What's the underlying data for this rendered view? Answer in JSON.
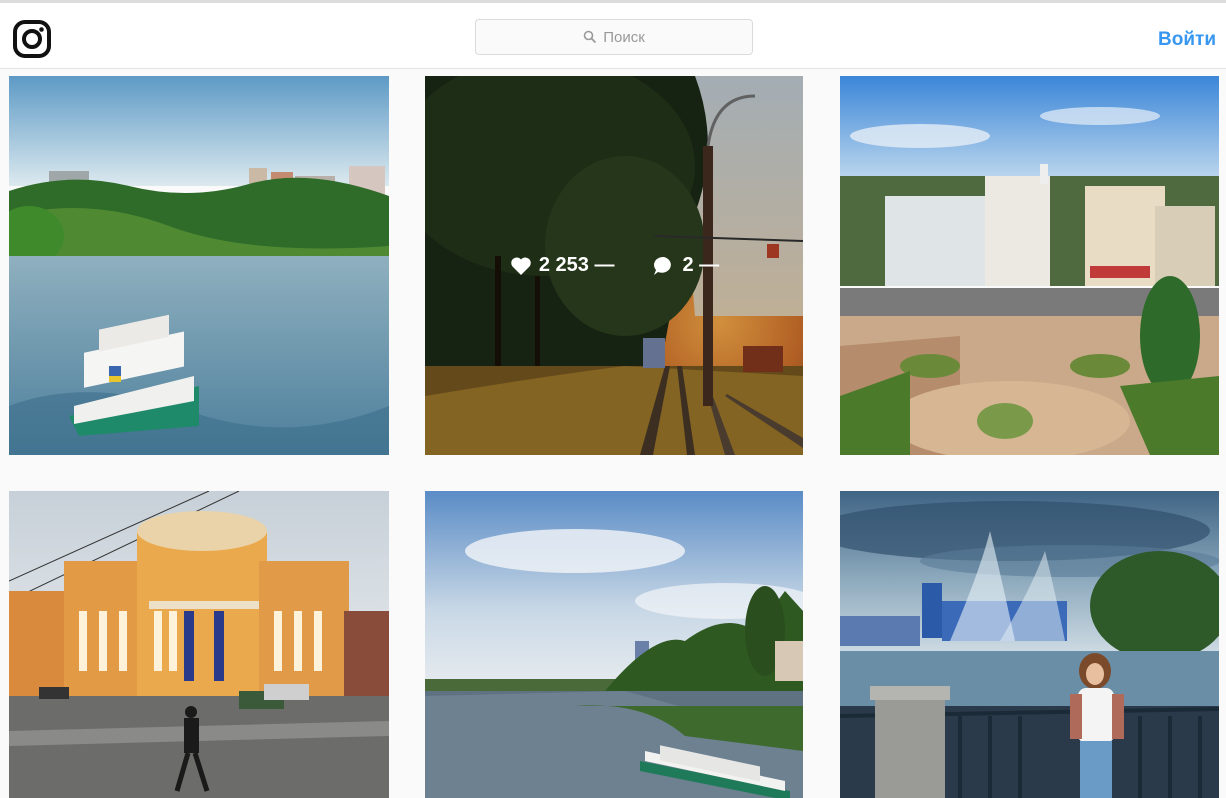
{
  "header": {
    "logo_icon": "instagram-camera-icon",
    "search_placeholder": "Поиск",
    "search_icon": "search-icon",
    "login_label": "Войти"
  },
  "colors": {
    "accent": "#3897f0",
    "border": "#dbdbdb",
    "background": "#fafafa"
  },
  "posts": [
    {
      "label": "river-boat-photo"
    },
    {
      "label": "tram-rails-sunset-photo",
      "likes": "2 253 —",
      "comments": "2 —"
    },
    {
      "label": "city-square-photo"
    },
    {
      "label": "yellow-building-photo"
    },
    {
      "label": "river-embankment-photo"
    },
    {
      "label": "fountain-girl-photo"
    }
  ]
}
